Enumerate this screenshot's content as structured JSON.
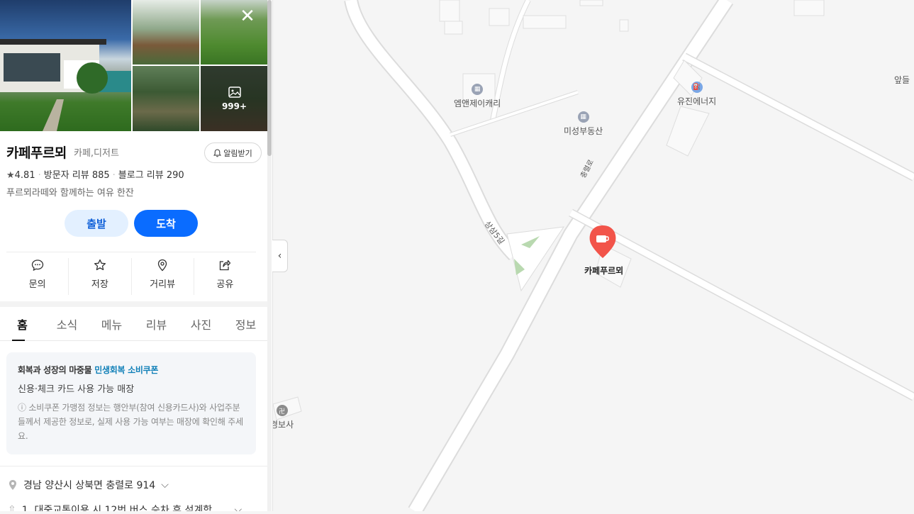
{
  "place": {
    "name": "카페푸르뫼",
    "category": "카페,디저트",
    "notify_label": "알림받기",
    "rating": "4.81",
    "visitor_reviews": "방문자 리뷰 885",
    "blog_reviews": "블로그 리뷰 290",
    "description": "푸르뫼라떼와 함께하는 여유 한잔",
    "photo_count": "999+"
  },
  "buttons": {
    "depart": "출발",
    "arrive": "도착"
  },
  "actions": [
    {
      "label": "문의",
      "icon": "chat-bubble-icon"
    },
    {
      "label": "저장",
      "icon": "star-icon"
    },
    {
      "label": "거리뷰",
      "icon": "location-pin-icon"
    },
    {
      "label": "공유",
      "icon": "share-icon"
    }
  ],
  "tabs": [
    "홈",
    "소식",
    "메뉴",
    "리뷰",
    "사진",
    "정보"
  ],
  "coupon": {
    "title_prefix": "회복과 성장의 마중물 ",
    "title_highlight": "민생회복 소비쿠폰",
    "subtitle": "신용·체크 카드 사용 가능 매장",
    "note": "소비쿠폰 가맹점 정보는 행안부(참여 신용카드사)와 사업주분들께서 제공한 정보로, 실제 사용 가능 여부는 매장에 확인해 주세요."
  },
  "info": {
    "address": "경남 양산시 상북면 충렬로 914",
    "route": "1. 대중교통이용 시 12번 버스 승차 후 석계학..."
  },
  "map": {
    "labels": {
      "emj": "엠앤제이캐리",
      "yujin": "유진에너지",
      "misung": "미성부동산",
      "apdeul": "앞들",
      "gyeongbosa": "경보사",
      "sangsam": "상삼5길",
      "road": "충렬로",
      "marker": "카페푸르뫼"
    },
    "colors": {
      "marker": "#f2544a",
      "road": "#ffffff",
      "background": "#f5f5f5",
      "green": "#b9d9b0"
    }
  }
}
